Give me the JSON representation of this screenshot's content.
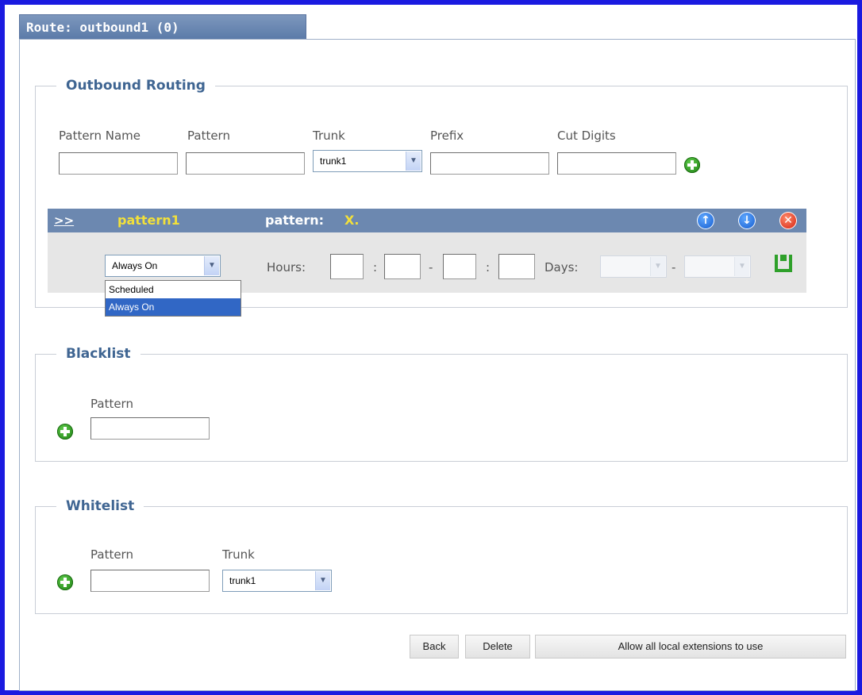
{
  "tab": {
    "title": "Route:  outbound1  (0)"
  },
  "outbound": {
    "legend": "Outbound Routing",
    "labels": {
      "pattern_name": "Pattern Name",
      "pattern": "Pattern",
      "trunk": "Trunk",
      "prefix": "Prefix",
      "cut_digits": "Cut Digits"
    },
    "inputs": {
      "pattern_name": "",
      "pattern": "",
      "prefix": "",
      "cut_digits": ""
    },
    "trunk_selected": "trunk1",
    "pattern_row": {
      "expand": ">>",
      "name": "pattern1",
      "pattern_label": "pattern:",
      "pattern_value": "X.",
      "schedule_selected": "Always On",
      "hours_label": "Hours:",
      "colon": ":",
      "dash": "-",
      "days_label": "Days:",
      "dropdown_options": [
        "Scheduled",
        "Always On"
      ]
    }
  },
  "blacklist": {
    "legend": "Blacklist",
    "pattern_label": "Pattern",
    "pattern_value": ""
  },
  "whitelist": {
    "legend": "Whitelist",
    "pattern_label": "Pattern",
    "trunk_label": "Trunk",
    "pattern_value": "",
    "trunk_selected": "trunk1"
  },
  "buttons": {
    "back": "Back",
    "delete": "Delete",
    "allow_all": "Allow all local extensions to use"
  },
  "icons": {
    "add": "plus-circle-icon",
    "move_up": "arrow-up-icon",
    "move_down": "arrow-down-icon",
    "remove": "close-icon",
    "save": "save-icon"
  },
  "colors": {
    "frame": "#1a1ae0",
    "header": "#6c88b0",
    "legend": "#3f6592",
    "pattern_name": "#f2e03a",
    "selected_option": "#3167c5"
  }
}
